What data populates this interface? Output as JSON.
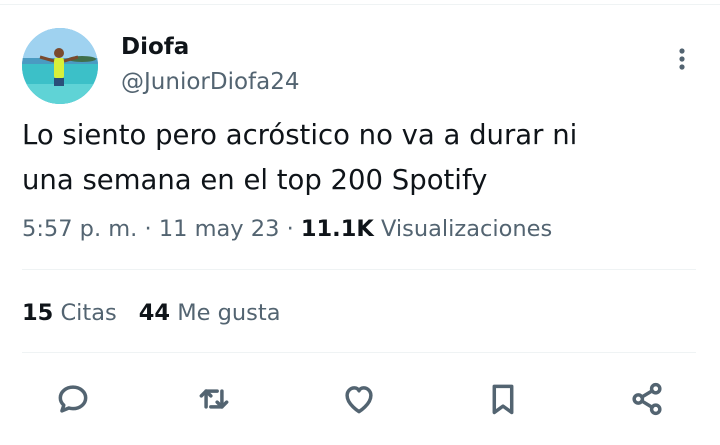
{
  "tweet": {
    "author": {
      "display_name": "Diofa",
      "handle": "@JuniorDiofa24"
    },
    "text_line1": "Lo siento pero acróstico no va a durar ni",
    "text_line2": "una semana en el top 200 Spotify",
    "time": "5:57 p. m.",
    "separator": "·",
    "date": "11 may 23",
    "views_count": "11.1K",
    "views_label": "Visualizaciones",
    "stats": {
      "quotes_count": "15",
      "quotes_label": "Citas",
      "likes_count": "44",
      "likes_label": "Me gusta"
    }
  },
  "icons": {
    "more": "more-vertical-icon",
    "reply": "reply-icon",
    "retweet": "retweet-icon",
    "like": "heart-icon",
    "bookmark": "bookmark-icon",
    "share": "share-icon"
  },
  "colors": {
    "text": "#0f1419",
    "secondary": "#536471",
    "divider": "#eff3f4"
  }
}
